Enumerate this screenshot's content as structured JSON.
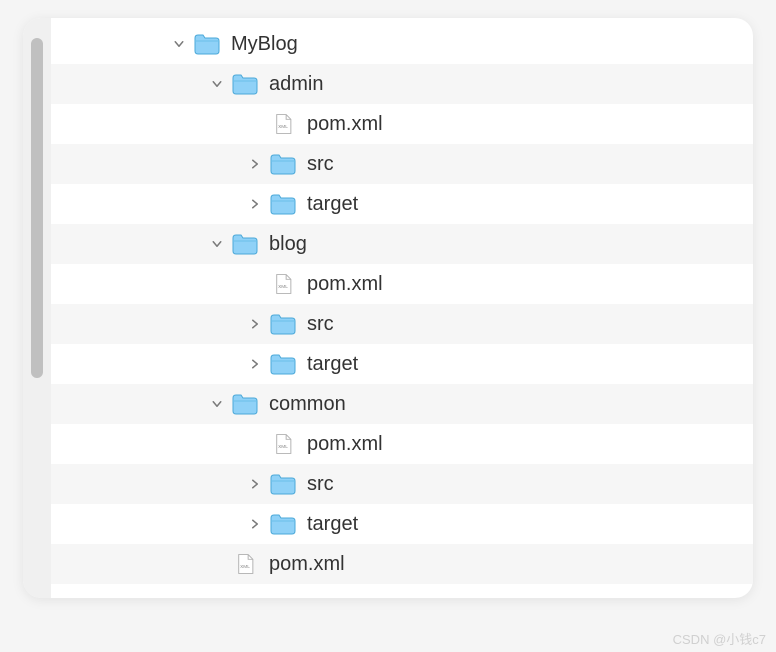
{
  "tree": {
    "rows": [
      {
        "label": "MyBlog",
        "type": "folder",
        "expanded": true,
        "indent": 1,
        "alt": false
      },
      {
        "label": "admin",
        "type": "folder",
        "expanded": true,
        "indent": 2,
        "alt": true
      },
      {
        "label": "pom.xml",
        "type": "xml",
        "expanded": null,
        "indent": 3,
        "alt": false
      },
      {
        "label": "src",
        "type": "folder",
        "expanded": false,
        "indent": 3,
        "alt": true
      },
      {
        "label": "target",
        "type": "folder",
        "expanded": false,
        "indent": 3,
        "alt": false
      },
      {
        "label": "blog",
        "type": "folder",
        "expanded": true,
        "indent": 2,
        "alt": true
      },
      {
        "label": "pom.xml",
        "type": "xml",
        "expanded": null,
        "indent": 3,
        "alt": false
      },
      {
        "label": "src",
        "type": "folder",
        "expanded": false,
        "indent": 3,
        "alt": true
      },
      {
        "label": "target",
        "type": "folder",
        "expanded": false,
        "indent": 3,
        "alt": false
      },
      {
        "label": "common",
        "type": "folder",
        "expanded": true,
        "indent": 2,
        "alt": true
      },
      {
        "label": "pom.xml",
        "type": "xml",
        "expanded": null,
        "indent": 3,
        "alt": false
      },
      {
        "label": "src",
        "type": "folder",
        "expanded": false,
        "indent": 3,
        "alt": true
      },
      {
        "label": "target",
        "type": "folder",
        "expanded": false,
        "indent": 3,
        "alt": false
      },
      {
        "label": "pom.xml",
        "type": "xml",
        "expanded": null,
        "indent": 2,
        "alt": true
      }
    ]
  },
  "watermark": "CSDN @小钱c7"
}
